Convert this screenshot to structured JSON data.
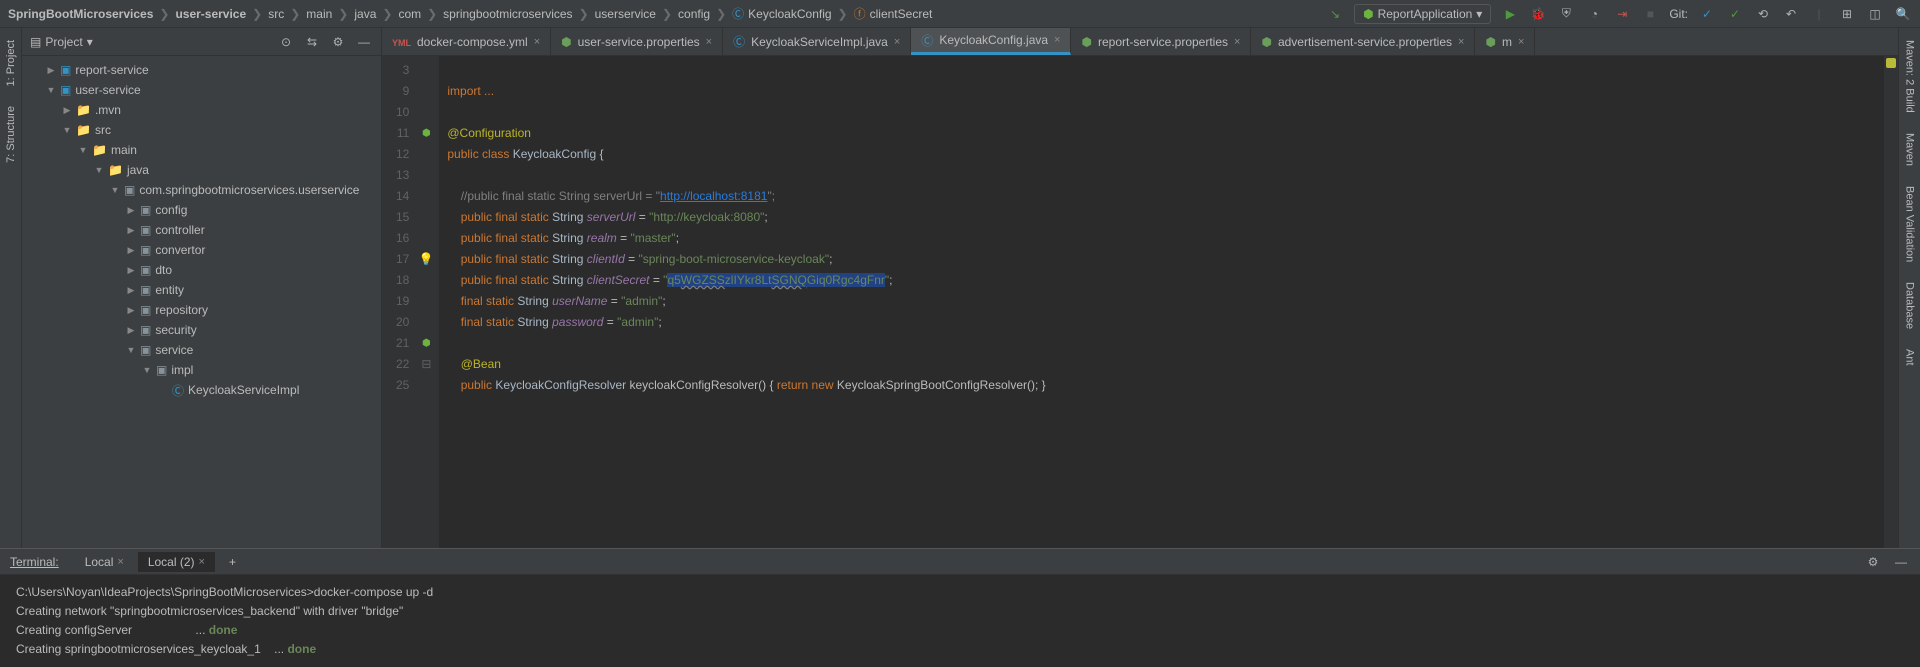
{
  "breadcrumbs": [
    "SpringBootMicroservices",
    "user-service",
    "src",
    "main",
    "java",
    "com",
    "springbootmicroservices",
    "userservice",
    "config",
    "KeycloakConfig",
    "clientSecret"
  ],
  "run_config": "ReportApplication",
  "git_label": "Git:",
  "left_tools": [
    "1: Project",
    "7: Structure"
  ],
  "right_tools": [
    "Maven: 2 Build",
    "Maven",
    "Bean Validation",
    "Database",
    "Ant"
  ],
  "project_panel_title": "Project",
  "tree": [
    {
      "indent": 1,
      "exp": "▶",
      "icon": "module",
      "label": "report-service"
    },
    {
      "indent": 1,
      "exp": "▼",
      "icon": "module",
      "label": "user-service"
    },
    {
      "indent": 2,
      "exp": "▶",
      "icon": "folder",
      "label": ".mvn"
    },
    {
      "indent": 2,
      "exp": "▼",
      "icon": "folder",
      "label": "src"
    },
    {
      "indent": 3,
      "exp": "▼",
      "icon": "folder",
      "label": "main"
    },
    {
      "indent": 4,
      "exp": "▼",
      "icon": "folder",
      "label": "java"
    },
    {
      "indent": 5,
      "exp": "▼",
      "icon": "pkg",
      "label": "com.springbootmicroservices.userservice"
    },
    {
      "indent": 6,
      "exp": "▶",
      "icon": "pkg",
      "label": "config"
    },
    {
      "indent": 6,
      "exp": "▶",
      "icon": "pkg",
      "label": "controller"
    },
    {
      "indent": 6,
      "exp": "▶",
      "icon": "pkg",
      "label": "convertor"
    },
    {
      "indent": 6,
      "exp": "▶",
      "icon": "pkg",
      "label": "dto"
    },
    {
      "indent": 6,
      "exp": "▶",
      "icon": "pkg",
      "label": "entity"
    },
    {
      "indent": 6,
      "exp": "▶",
      "icon": "pkg",
      "label": "repository"
    },
    {
      "indent": 6,
      "exp": "▶",
      "icon": "pkg",
      "label": "security"
    },
    {
      "indent": 6,
      "exp": "▼",
      "icon": "pkg",
      "label": "service"
    },
    {
      "indent": 7,
      "exp": "▼",
      "icon": "pkg",
      "label": "impl"
    },
    {
      "indent": 8,
      "exp": "",
      "icon": "class",
      "label": "KeycloakServiceImpl"
    }
  ],
  "tabs": [
    {
      "icon": "yml",
      "label": "docker-compose.yml"
    },
    {
      "icon": "props",
      "label": "user-service.properties"
    },
    {
      "icon": "java",
      "label": "KeycloakServiceImpl.java"
    },
    {
      "icon": "java",
      "label": "KeycloakConfig.java",
      "active": true
    },
    {
      "icon": "props",
      "label": "report-service.properties"
    },
    {
      "icon": "props",
      "label": "advertisement-service.properties"
    },
    {
      "icon": "props",
      "label": "m"
    }
  ],
  "line_numbers": [
    "3",
    "9",
    "10",
    "11",
    "12",
    "13",
    "14",
    "15",
    "16",
    "17",
    "18",
    "19",
    "20",
    "21",
    "22",
    "25"
  ],
  "code": {
    "l3": "import ...",
    "l10": "@Configuration",
    "l11_pre": "public class ",
    "l11_cls": "KeycloakConfig",
    "l11_post": " {",
    "l13_c": "//public final static String serverUrl = \"",
    "l13_u": "http://localhost:8181",
    "l13_e": "\";",
    "l14_k": "public final static ",
    "l14_t": "String ",
    "l14_f": "serverUrl",
    "l14_eq": " = ",
    "l14_s": "\"http://keycloak:8080\"",
    "l14_sc": ";",
    "l15_k": "public final static ",
    "l15_t": "String ",
    "l15_f": "realm",
    "l15_eq": " = ",
    "l15_s": "\"master\"",
    "l15_sc": ";",
    "l16_k": "public final static ",
    "l16_t": "String ",
    "l16_f": "clientId",
    "l16_eq": " = ",
    "l16_s": "\"spring-boot-microservice-keycloak\"",
    "l16_sc": ";",
    "l17_k": "public final static ",
    "l17_t": "String ",
    "l17_f": "clientSecret",
    "l17_eq": " = ",
    "l17_q": "\"",
    "l17_sel1": "q5",
    "l17_sel2": "WGZSS",
    "l17_sel3": "zlIYkr8Lt",
    "l17_sel4": "SGNQ",
    "l17_sel5": "Giq0Rgc4gFnr",
    "l17_qe": "\"",
    "l17_sc": ";",
    "l18_k": "final static ",
    "l18_t": "String ",
    "l18_f": "userName",
    "l18_eq": " = ",
    "l18_s": "\"admin\"",
    "l18_sc": ";",
    "l19_k": "final static ",
    "l19_t": "String ",
    "l19_f": "password",
    "l19_eq": " = ",
    "l19_s": "\"admin\"",
    "l19_sc": ";",
    "l21": "@Bean",
    "l22_k": "public ",
    "l22_t": "KeycloakConfigResolver ",
    "l22_m": "keycloakConfigResolver",
    "l22_p": "() { ",
    "l22_r": "return new ",
    "l22_c": "KeycloakSpringBootConfigResolver(); }"
  },
  "terminal": {
    "label": "Terminal:",
    "tabs": [
      "Local",
      "Local (2)"
    ],
    "prompt": "C:\\Users\\Noyan\\IdeaProjects\\SpringBootMicroservices>",
    "cmd": "docker-compose up -d",
    "lines": [
      "Creating network \"springbootmicroservices_backend\" with driver \"bridge\"",
      "Creating configServer                   ... ",
      "Creating springbootmicroservices_keycloak_1    ... "
    ],
    "done": "done"
  }
}
